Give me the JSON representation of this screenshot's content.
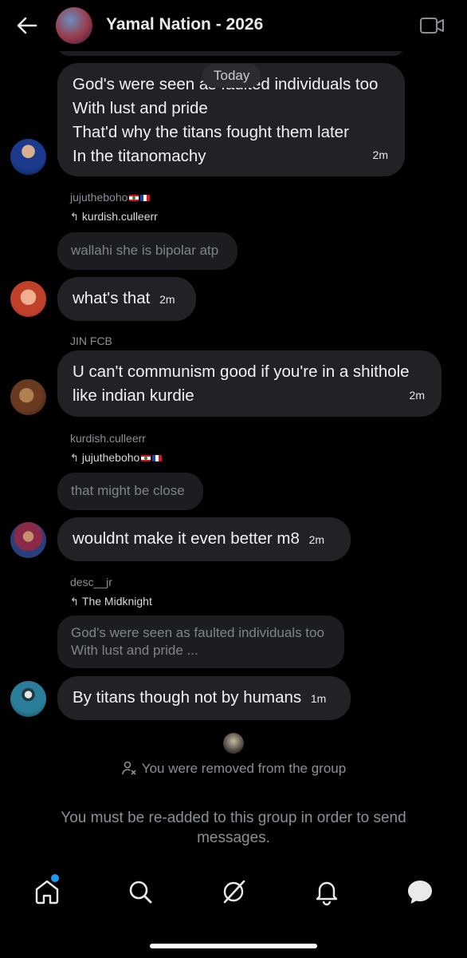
{
  "header": {
    "title": "Yamal Nation - 2026",
    "back_icon": "back-arrow-icon",
    "video_icon": "video-call-icon"
  },
  "date_divider": "Today",
  "messages": [
    {
      "lines": [
        "God's were seen as faulted individuals too",
        "With lust and pride",
        "That'd why the titans fought them later",
        "In the titanomachy"
      ],
      "time": "2m"
    },
    {
      "sender": "jujutheboho",
      "reply_to": "kurdish.culleerr",
      "quoted": "wallahi she is bipolar atp",
      "lines": [
        "what's that"
      ],
      "time": "2m"
    },
    {
      "sender": "JIN FCB",
      "lines": [
        "U can't communism good if you're in a shithole",
        "like indian kurdie"
      ],
      "time": "2m"
    },
    {
      "sender": "kurdish.culleerr",
      "reply_to": "jujutheboho",
      "quoted": "that might be close",
      "lines": [
        "wouldnt make it even better m8"
      ],
      "time": "2m"
    },
    {
      "sender": "desc__jr",
      "reply_to": "The Midknight",
      "quoted_lines": [
        "God's were seen as faulted individuals too",
        "With lust and pride ..."
      ],
      "lines": [
        "By titans though not by humans"
      ],
      "time": "1m"
    }
  ],
  "system_message": "You were removed from the group",
  "notice": "You must be re-added to this group in order to send messages.",
  "nav": [
    "home-icon",
    "search-icon",
    "grok-icon",
    "notifications-bell-icon",
    "messages-icon"
  ],
  "colors": {
    "accent": "#1d9bf0",
    "bubble": "#202226",
    "background": "#000000"
  }
}
